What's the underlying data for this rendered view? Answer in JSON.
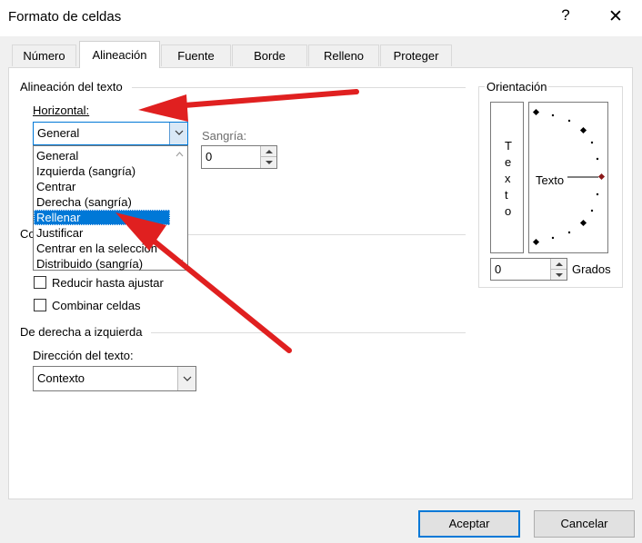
{
  "window": {
    "title": "Formato de celdas",
    "help_glyph": "?",
    "close_glyph": "✕"
  },
  "tabs": [
    {
      "label": "Número",
      "active": false
    },
    {
      "label": "Alineación",
      "active": true
    },
    {
      "label": "Fuente",
      "active": false
    },
    {
      "label": "Borde",
      "active": false
    },
    {
      "label": "Relleno",
      "active": false
    },
    {
      "label": "Proteger",
      "active": false
    }
  ],
  "text_alignment": {
    "section_title": "Alineación del texto",
    "horizontal_label": "Horizontal:",
    "horizontal_value": "General",
    "indent_label": "Sangría:",
    "indent_value": "0",
    "options": [
      "General",
      "Izquierda (sangría)",
      "Centrar",
      "Derecha (sangría)",
      "Rellenar",
      "Justificar",
      "Centrar en la selección",
      "Distribuido (sangría)"
    ],
    "selected_option": "Rellenar"
  },
  "text_control": {
    "section_title_partial": "Co",
    "shrink_label": "Reducir hasta ajustar",
    "merge_label": "Combinar celdas",
    "shrink_checked": false,
    "merge_checked": false
  },
  "rtl": {
    "section_title": "De derecha a izquierda",
    "direction_label": "Dirección del texto:",
    "direction_value": "Contexto"
  },
  "orientation": {
    "section_title": "Orientación",
    "vertical_letters": [
      "T",
      "e",
      "x",
      "t",
      "o"
    ],
    "dial_text": "Texto",
    "degrees_value": "0",
    "degrees_label": "Grados"
  },
  "buttons": {
    "ok": "Aceptar",
    "cancel": "Cancelar"
  },
  "colors": {
    "annotation_arrow": "#e02020",
    "selection": "#0078d7",
    "dial_marker": "#8b1a1a"
  }
}
